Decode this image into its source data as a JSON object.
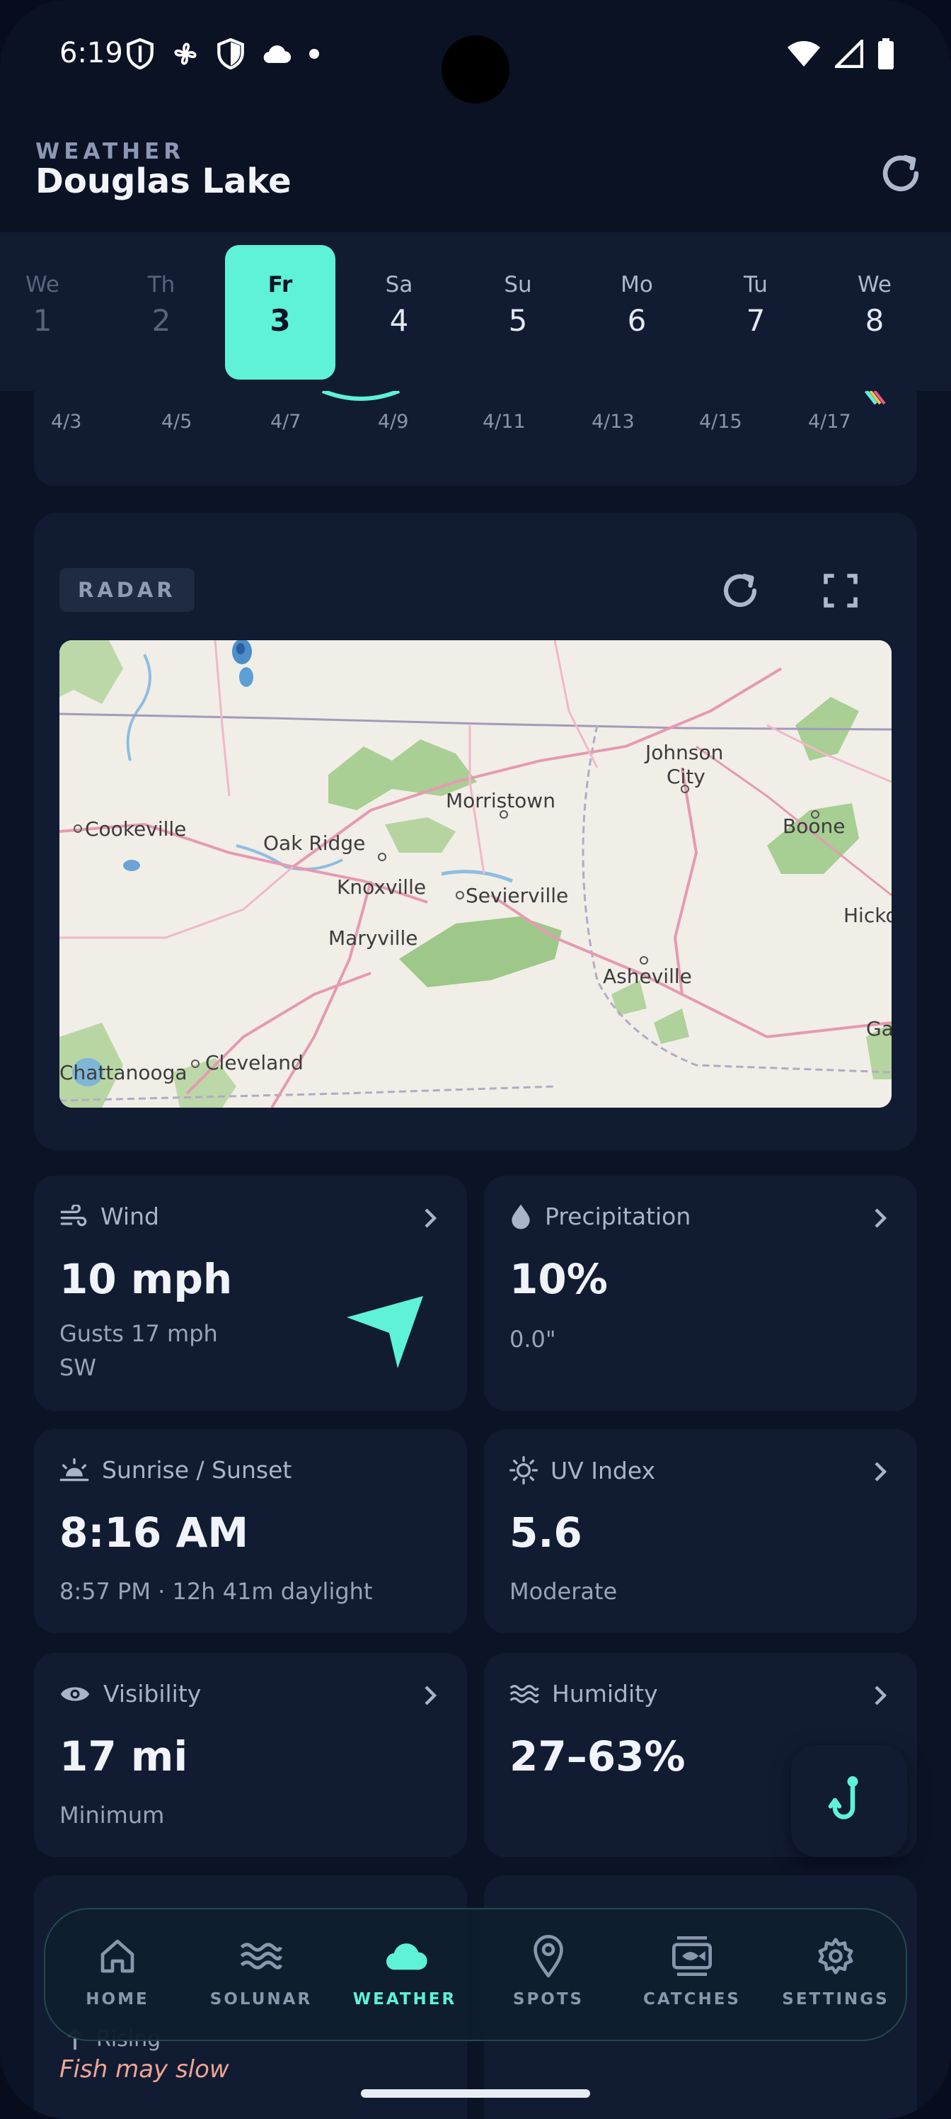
{
  "status_bar": {
    "time": "6:19"
  },
  "header": {
    "overline": "WEATHER",
    "title": "Douglas Lake"
  },
  "days": [
    {
      "name": "We",
      "num": "1"
    },
    {
      "name": "Th",
      "num": "2"
    },
    {
      "name": "Fr",
      "num": "3"
    },
    {
      "name": "Sa",
      "num": "4"
    },
    {
      "name": "Su",
      "num": "5"
    },
    {
      "name": "Mo",
      "num": "6"
    },
    {
      "name": "Tu",
      "num": "7"
    },
    {
      "name": "We",
      "num": "8"
    }
  ],
  "chart": {
    "x_labels": [
      "4/3",
      "4/5",
      "4/7",
      "4/9",
      "4/11",
      "4/13",
      "4/15",
      "4/17"
    ]
  },
  "radar": {
    "badge": "RADAR",
    "map_labels": [
      "Johnson",
      "City",
      "Morristown",
      "Cookeville",
      "Boone",
      "Oak Ridge",
      "Knoxville",
      "Sevierville",
      "Hicko",
      "Maryville",
      "Asheville",
      "Ga",
      "Chattanooga",
      "Cleveland"
    ]
  },
  "cards": {
    "wind": {
      "label": "Wind",
      "value": "10 mph",
      "gusts": "Gusts 17 mph",
      "direction": "SW"
    },
    "precip": {
      "label": "Precipitation",
      "value": "10%",
      "amount": "0.0\""
    },
    "sun": {
      "label": "Sunrise / Sunset",
      "value": "8:16 AM",
      "sub": "8:57 PM · 12h 41m daylight"
    },
    "uv": {
      "label": "UV Index",
      "value": "5.6",
      "sub": "Moderate"
    },
    "visibility": {
      "label": "Visibility",
      "value": "17 mi",
      "sub": "Minimum"
    },
    "humidity": {
      "label": "Humidity",
      "value": "27–63%"
    }
  },
  "under_nav": {
    "trend": "Rising",
    "note": "Fish may slow"
  },
  "nav": [
    {
      "label": "HOME"
    },
    {
      "label": "SOLUNAR"
    },
    {
      "label": "WEATHER"
    },
    {
      "label": "SPOTS"
    },
    {
      "label": "CATCHES"
    },
    {
      "label": "SETTINGS"
    }
  ],
  "colors": {
    "accent": "#5ef2d8",
    "background": "#0b1326",
    "card": "#111c33",
    "warning_text": "#f0a592"
  }
}
